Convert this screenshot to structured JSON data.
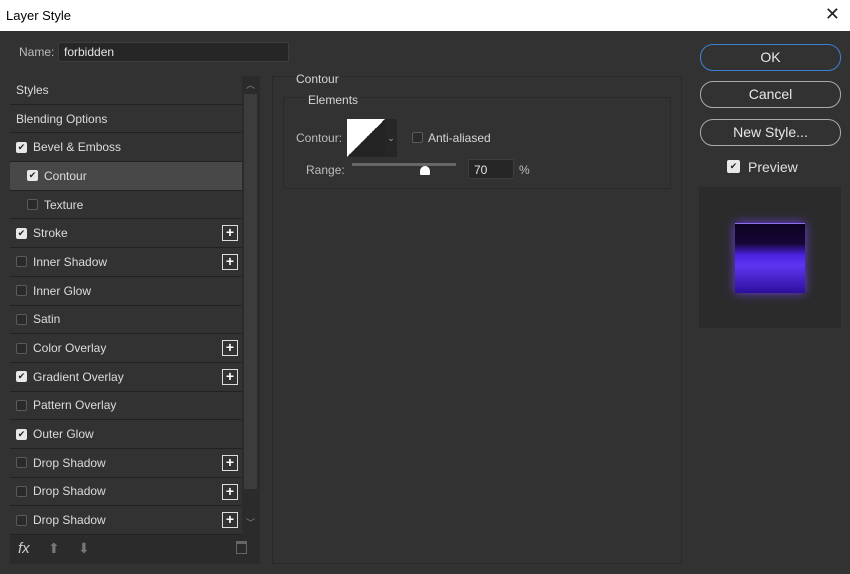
{
  "window": {
    "title": "Layer Style",
    "close": "✕"
  },
  "name": {
    "label": "Name:",
    "value": "forbidden"
  },
  "styles_list": [
    {
      "label": "Styles",
      "checkbox": null,
      "plus": false
    },
    {
      "label": "Blending Options",
      "checkbox": null,
      "plus": false
    },
    {
      "label": "Bevel & Emboss",
      "checkbox": true,
      "plus": false
    },
    {
      "label": "Contour",
      "checkbox": true,
      "plus": false,
      "indent": true,
      "selected": true
    },
    {
      "label": "Texture",
      "checkbox": false,
      "plus": false,
      "indent": true
    },
    {
      "label": "Stroke",
      "checkbox": true,
      "plus": true
    },
    {
      "label": "Inner Shadow",
      "checkbox": false,
      "plus": true
    },
    {
      "label": "Inner Glow",
      "checkbox": false,
      "plus": false
    },
    {
      "label": "Satin",
      "checkbox": false,
      "plus": false
    },
    {
      "label": "Color Overlay",
      "checkbox": false,
      "plus": true
    },
    {
      "label": "Gradient Overlay",
      "checkbox": true,
      "plus": true
    },
    {
      "label": "Pattern Overlay",
      "checkbox": false,
      "plus": false
    },
    {
      "label": "Outer Glow",
      "checkbox": true,
      "plus": false
    },
    {
      "label": "Drop Shadow",
      "checkbox": false,
      "plus": true
    },
    {
      "label": "Drop Shadow",
      "checkbox": false,
      "plus": true
    },
    {
      "label": "Drop Shadow",
      "checkbox": false,
      "plus": true
    }
  ],
  "footer": {
    "fx": "fx"
  },
  "contour": {
    "section": "Contour",
    "group": "Elements",
    "contour_label": "Contour:",
    "anti_aliased": "Anti-aliased",
    "range_label": "Range:",
    "range_value": "70",
    "range_unit": "%",
    "range_fraction": 0.7
  },
  "buttons": {
    "ok": "OK",
    "cancel": "Cancel",
    "new_style": "New Style...",
    "preview": "Preview"
  }
}
